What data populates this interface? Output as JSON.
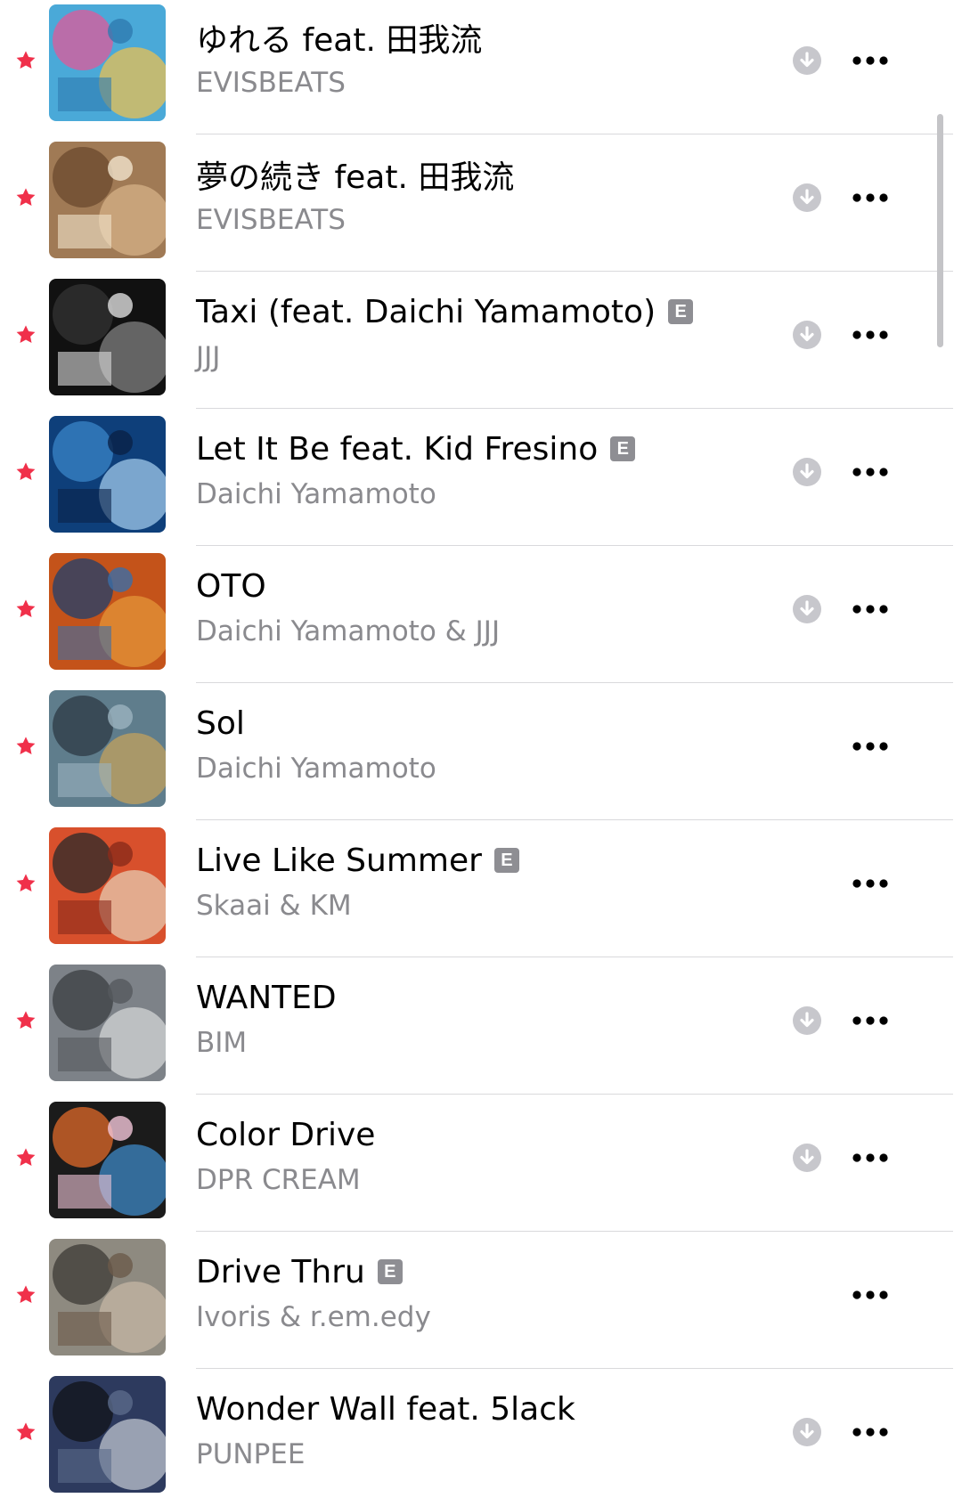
{
  "colors": {
    "star": "#f0304a",
    "title": "#000000",
    "artist": "#8a8a8e",
    "download_icon": "#c7c7cc",
    "more_icon": "#000000",
    "explicit_badge": "#8e8e93"
  },
  "icons": {
    "star": "star-icon",
    "download": "download-icon",
    "more": "more-icon",
    "explicit": "explicit-badge"
  },
  "songs": [
    {
      "title": "ゆれる feat. 田我流",
      "artist": "EVISBEATS",
      "explicit": false,
      "downloadable": true
    },
    {
      "title": "夢の続き feat. 田我流",
      "artist": "EVISBEATS",
      "explicit": false,
      "downloadable": true
    },
    {
      "title": "Taxi (feat. Daichi Yamamoto)",
      "artist": "JJJ",
      "explicit": true,
      "downloadable": true
    },
    {
      "title": "Let It Be feat. Kid Fresino",
      "artist": "Daichi Yamamoto",
      "explicit": true,
      "downloadable": true
    },
    {
      "title": "OTO",
      "artist": "Daichi Yamamoto & JJJ",
      "explicit": false,
      "downloadable": true
    },
    {
      "title": "Sol",
      "artist": "Daichi Yamamoto",
      "explicit": false,
      "downloadable": false
    },
    {
      "title": "Live Like Summer",
      "artist": "Skaai & KM",
      "explicit": true,
      "downloadable": false
    },
    {
      "title": "WANTED",
      "artist": "BIM",
      "explicit": false,
      "downloadable": true
    },
    {
      "title": "Color Drive",
      "artist": "DPR CREAM",
      "explicit": false,
      "downloadable": true
    },
    {
      "title": "Drive Thru",
      "artist": "Ivoris & r.em.edy",
      "explicit": true,
      "downloadable": false
    },
    {
      "title": "Wonder Wall feat. 5lack",
      "artist": "PUNPEE",
      "explicit": false,
      "downloadable": true
    }
  ],
  "explicit_label": "E"
}
